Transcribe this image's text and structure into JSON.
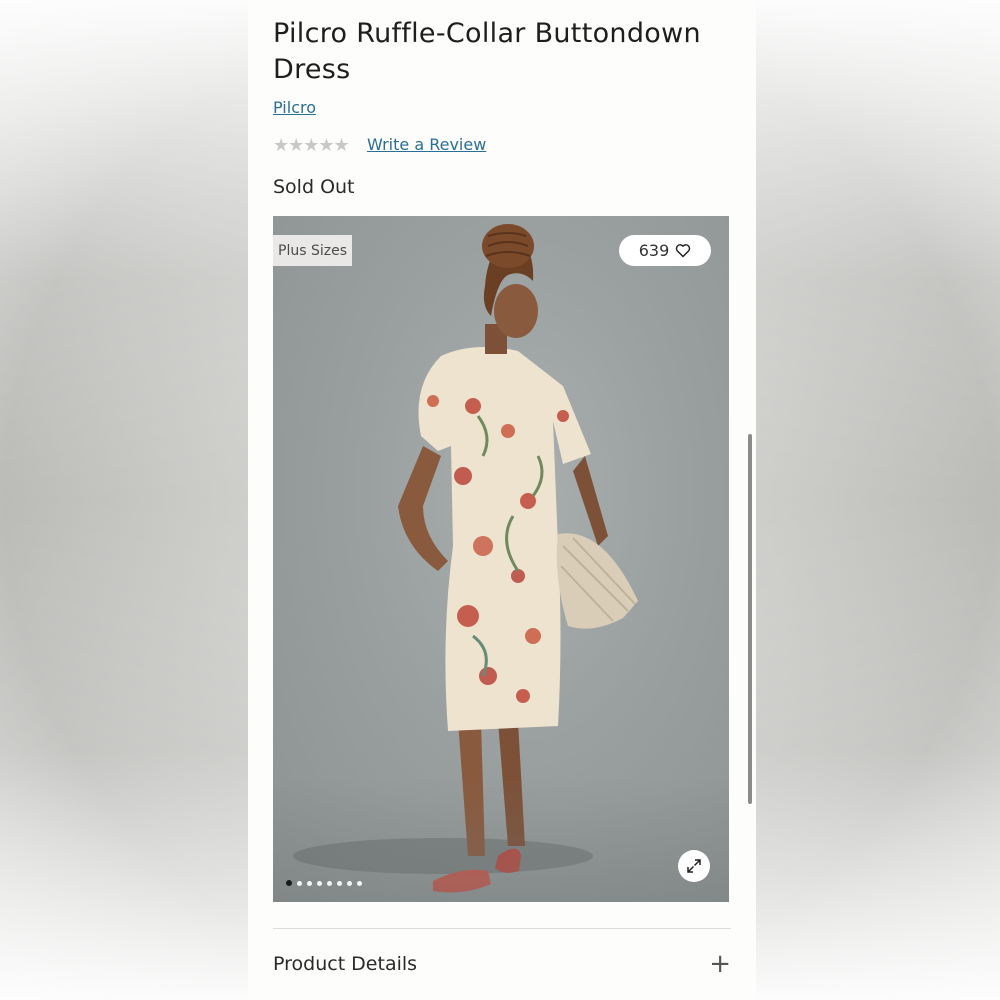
{
  "product": {
    "title": "Pilcro Ruffle-Collar Buttondown Dress",
    "brand": "Pilcro",
    "rating_stars": "★★★★★",
    "review_link": "Write a Review",
    "status": "Sold Out"
  },
  "gallery": {
    "badge": "Plus Sizes",
    "likes": "639",
    "total_images": 8,
    "active_index": 0
  },
  "accordion": {
    "product_details_label": "Product Details",
    "toggle": "+"
  },
  "colors": {
    "link": "#2a6f95",
    "background": "#fdfdfb"
  },
  "icons": [
    "heart-icon",
    "expand-icon",
    "plus-icon",
    "star-icon"
  ]
}
